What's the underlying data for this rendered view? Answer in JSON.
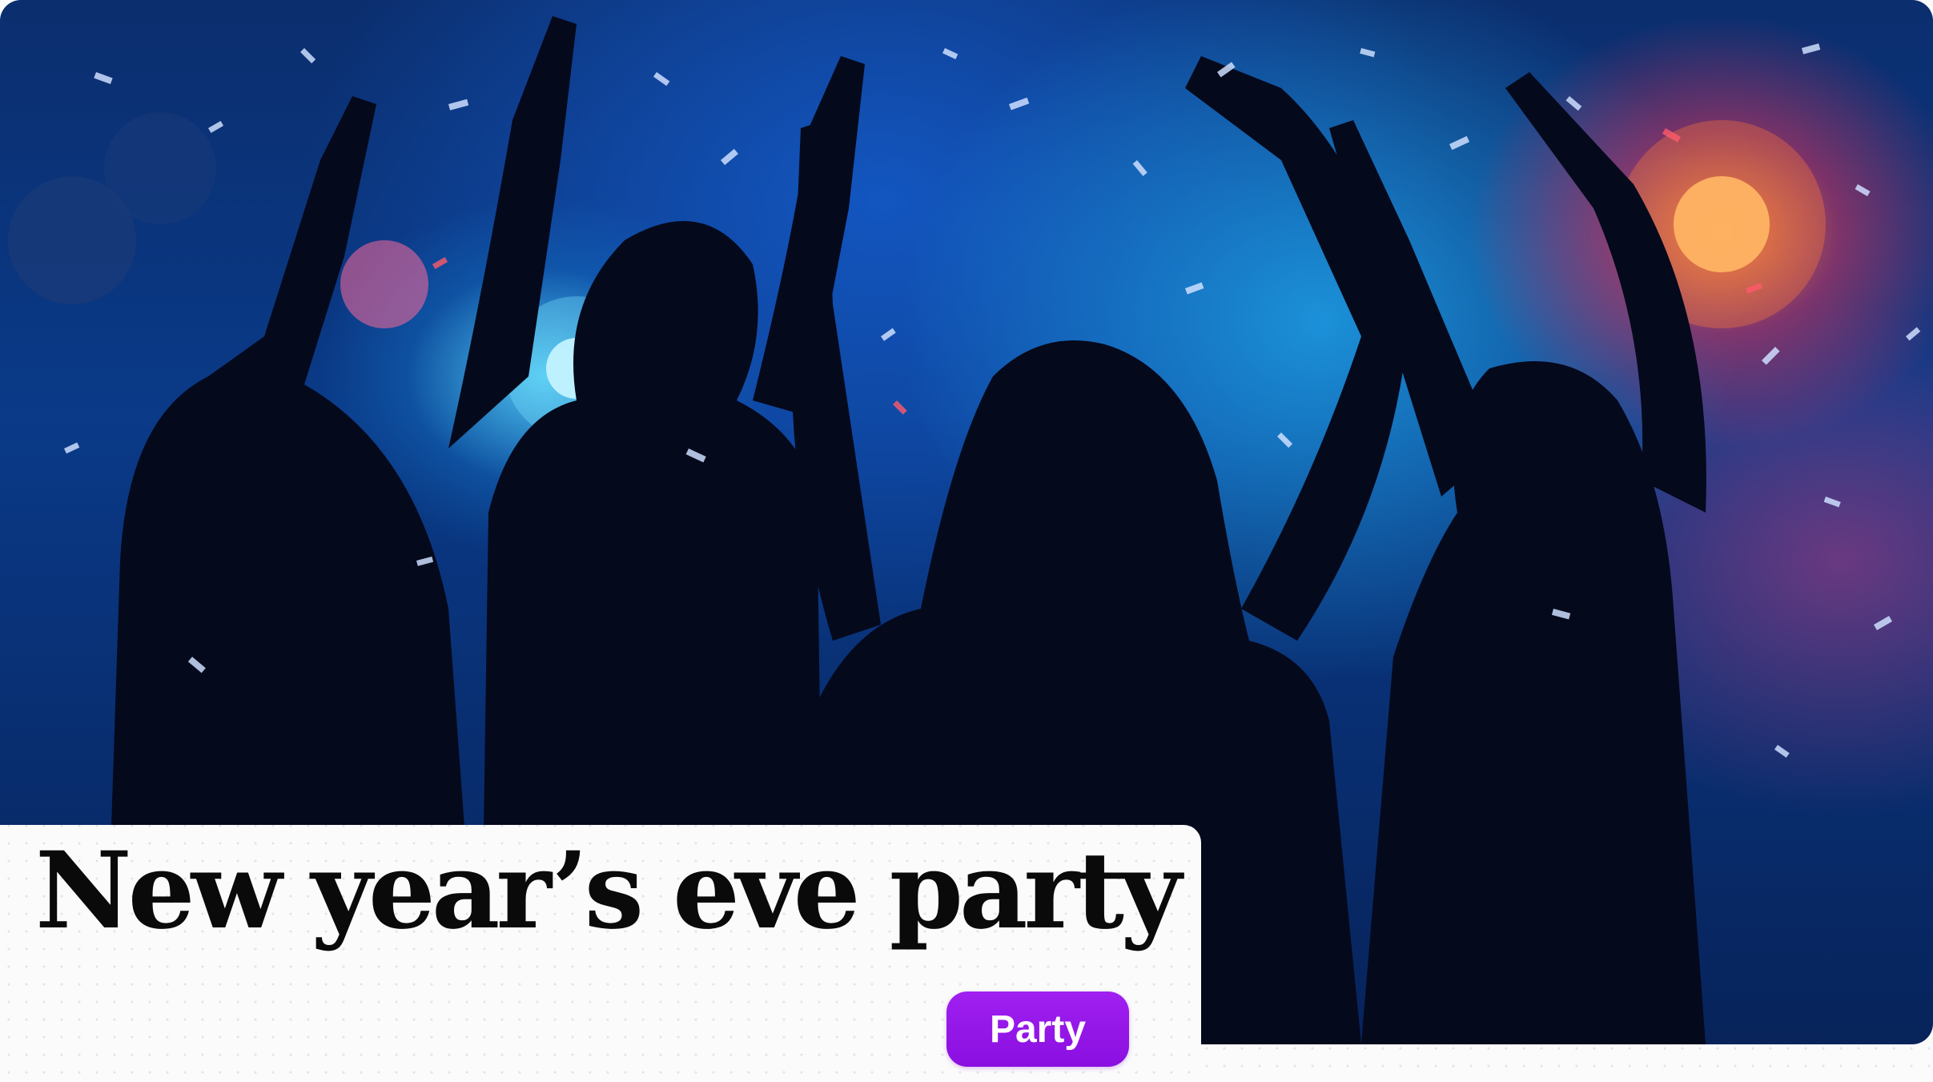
{
  "event": {
    "title": "New year’s eve party",
    "tag_label": "Party"
  },
  "image": {
    "alt": "Silhouettes of people dancing under blue and red lights with falling confetti"
  },
  "colors": {
    "tag_background": "#9b1ff0",
    "tag_text": "#ffffff",
    "title_text": "#0a0a0a",
    "photo_blue": "#0a3a88",
    "photo_cyan": "#5adcff",
    "photo_red": "#e03a5a",
    "photo_orange": "#ff8c3c"
  }
}
